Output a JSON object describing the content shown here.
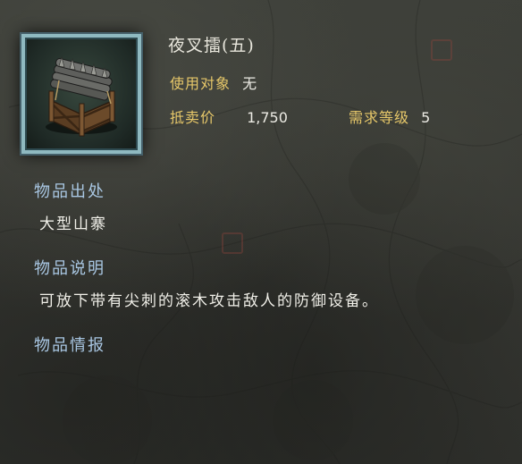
{
  "item": {
    "name": "夜叉擂(五)",
    "use_target_label": "使用对象",
    "use_target_value": "无",
    "sell_price_label": "抵卖价",
    "sell_price_value": "1,750",
    "required_level_label": "需求等级",
    "required_level_value": "5",
    "icon": "spiked-log-trap-icon"
  },
  "sections": {
    "origin_title": "物品出处",
    "origin_text": "大型山寨",
    "description_title": "物品说明",
    "description_text": "可放下带有尖刺的滚木攻击敌人的防御设备。",
    "intel_title": "物品情报"
  },
  "colors": {
    "label_gold": "#e6c769",
    "section_blue": "#a9c7e3",
    "frame_teal": "#8fb9c0"
  }
}
